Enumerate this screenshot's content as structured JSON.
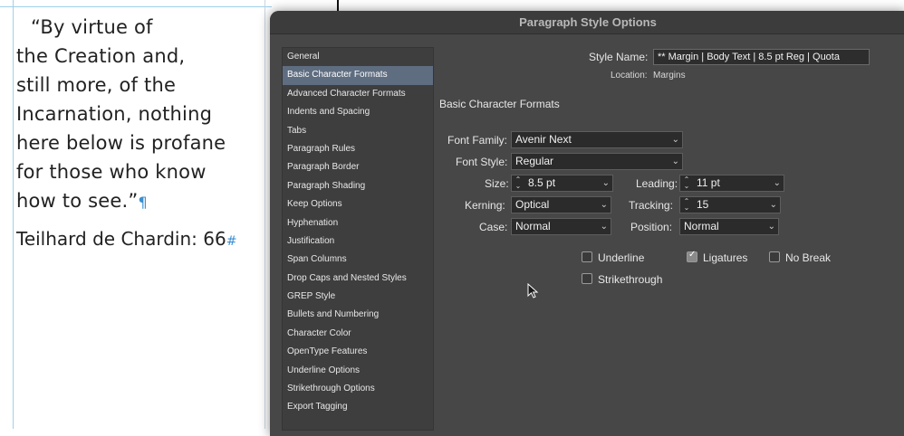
{
  "document": {
    "quote_lines": [
      "“By virtue of",
      "the Creation and,",
      "still more, of the",
      "Incarnation, nothing",
      "here below is profane",
      "for those who know",
      "how to see.”"
    ],
    "pilcrow": "¶",
    "attribution": "Teilhard de Chardin: 66",
    "hash_mark": "#"
  },
  "dialog": {
    "title": "Paragraph Style Options",
    "style_name_label": "Style Name:",
    "style_name_value": "** Margin | Body Text | 8.5 pt Reg | Quota",
    "location_label": "Location:",
    "location_value": "Margins",
    "section_title": "Basic Character Formats",
    "sidebar": [
      "General",
      "Basic Character Formats",
      "Advanced Character Formats",
      "Indents and Spacing",
      "Tabs",
      "Paragraph Rules",
      "Paragraph Border",
      "Paragraph Shading",
      "Keep Options",
      "Hyphenation",
      "Justification",
      "Span Columns",
      "Drop Caps and Nested Styles",
      "GREP Style",
      "Bullets and Numbering",
      "Character Color",
      "OpenType Features",
      "Underline Options",
      "Strikethrough Options",
      "Export Tagging"
    ],
    "selected_index": 1,
    "fields": {
      "font_family_label": "Font Family:",
      "font_family_value": "Avenir Next",
      "font_style_label": "Font Style:",
      "font_style_value": "Regular",
      "size_label": "Size:",
      "size_value": "8.5 pt",
      "leading_label": "Leading:",
      "leading_value": "11 pt",
      "kerning_label": "Kerning:",
      "kerning_value": "Optical",
      "tracking_label": "Tracking:",
      "tracking_value": "15",
      "case_label": "Case:",
      "case_value": "Normal",
      "position_label": "Position:",
      "position_value": "Normal"
    },
    "checkboxes": {
      "underline": {
        "label": "Underline",
        "checked": false
      },
      "ligatures": {
        "label": "Ligatures",
        "checked": true
      },
      "no_break": {
        "label": "No Break",
        "checked": false
      },
      "strikethrough": {
        "label": "Strikethrough",
        "checked": false
      }
    },
    "icons": {
      "chevron": "chevron-down-icon",
      "stepper": "stepper-icon",
      "cursor": "mouse-pointer-icon"
    }
  }
}
